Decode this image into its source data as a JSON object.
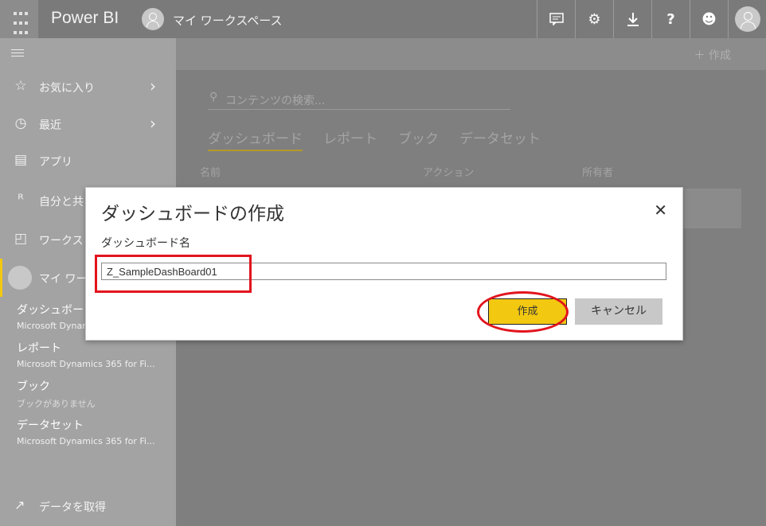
{
  "topbar": {
    "app_name": "Power BI",
    "workspace": "マイ ワークスペース",
    "icons": [
      "waffle-icon",
      "notifications-icon",
      "settings-icon",
      "download-icon",
      "help-icon",
      "feedback-icon",
      "user-icon"
    ]
  },
  "sidebar": {
    "items": [
      {
        "label": "お気に入り",
        "icon": "☆"
      },
      {
        "label": "最近",
        "icon": "◷"
      },
      {
        "label": "アプリ",
        "icon": "▤"
      },
      {
        "label": "自分と共",
        "icon": "ᴿ"
      },
      {
        "label": "ワークス",
        "icon": "◰"
      }
    ],
    "my_workspace": "マイ ワー",
    "sections": [
      {
        "title": "ダッシュボー",
        "sub": "Microsoft Dynar"
      },
      {
        "title": "レポート",
        "sub": "Microsoft Dynamics 365 for Fi..."
      },
      {
        "title": "ブック",
        "sub": "ブックがありません"
      },
      {
        "title": "データセット",
        "sub": "Microsoft Dynamics 365 for Fi..."
      }
    ],
    "get_data": "データを取得"
  },
  "main": {
    "create": "＋ 作成",
    "search_placeholder": "コンテンツの検索...",
    "tabs": [
      "ダッシュボード",
      "レポート",
      "ブック",
      "データセット"
    ],
    "columns": [
      "名前",
      "アクション",
      "所有者"
    ]
  },
  "dialog": {
    "title": "ダッシュボードの作成",
    "field_label": "ダッシュボード名",
    "field_value": "Z_SampleDashBoard01",
    "create_button": "作成",
    "cancel_button": "キャンセル"
  },
  "colors": {
    "accent": "#f2c811",
    "highlight": "#e2141d"
  }
}
